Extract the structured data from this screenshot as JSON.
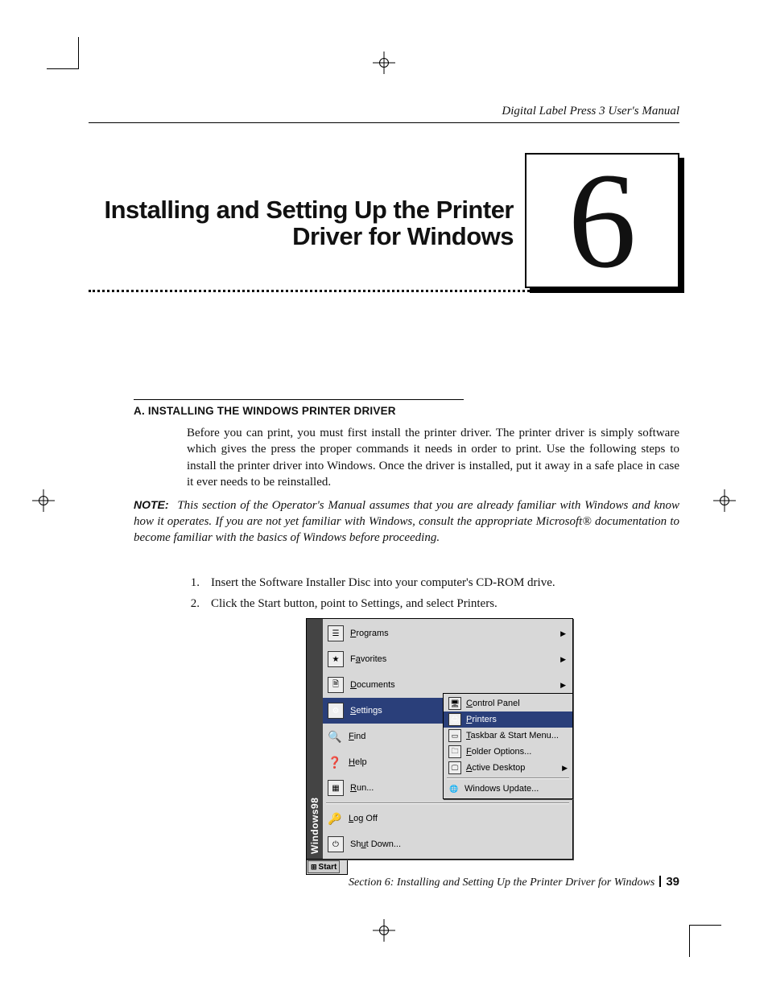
{
  "running_head": "Digital Label Press 3 User's Manual",
  "chapter": {
    "number": "6",
    "title": "Installing and Setting Up the Printer Driver for Windows"
  },
  "section": {
    "heading": "A. INSTALLING THE WINDOWS PRINTER DRIVER",
    "body": "Before you can print, you must first install the printer driver. The printer driver is simply software which gives the press the proper commands it needs in order to print. Use the following steps to install the printer driver into Windows. Once the driver is installed, put it away in a safe place in case it ever needs to be reinstalled."
  },
  "note": {
    "label": "NOTE:",
    "text": "This section of the Operator's Manual assumes that you are already familiar with Windows and know how it operates. If you are not yet familiar with Windows, consult the appropriate Microsoft® documentation to become familiar with the basics of Windows before proceeding."
  },
  "steps": [
    {
      "n": "1.",
      "t": "Insert the Software Installer Disc into your computer's CD-ROM drive."
    },
    {
      "n": "2.",
      "t": "Click the Start button, point to Settings, and select Printers."
    }
  ],
  "startmenu": {
    "brand": "Windows98",
    "items": {
      "programs": "Programs",
      "favorites": "Favorites",
      "documents": "Documents",
      "settings": "Settings",
      "find": "Find",
      "help": "Help",
      "run": "Run...",
      "logoff": "Log Off",
      "shutdown": "Shut Down..."
    },
    "submenu": {
      "control_panel": "Control Panel",
      "printers": "Printers",
      "taskbar": "Taskbar & Start Menu...",
      "folder_opts": "Folder Options...",
      "active_desk": "Active Desktop",
      "win_update": "Windows Update..."
    },
    "taskbar": {
      "start": "Start"
    }
  },
  "footer": {
    "section_label": "Section 6:  Installing and Setting Up the Printer Driver for Windows",
    "page_number": "39"
  }
}
